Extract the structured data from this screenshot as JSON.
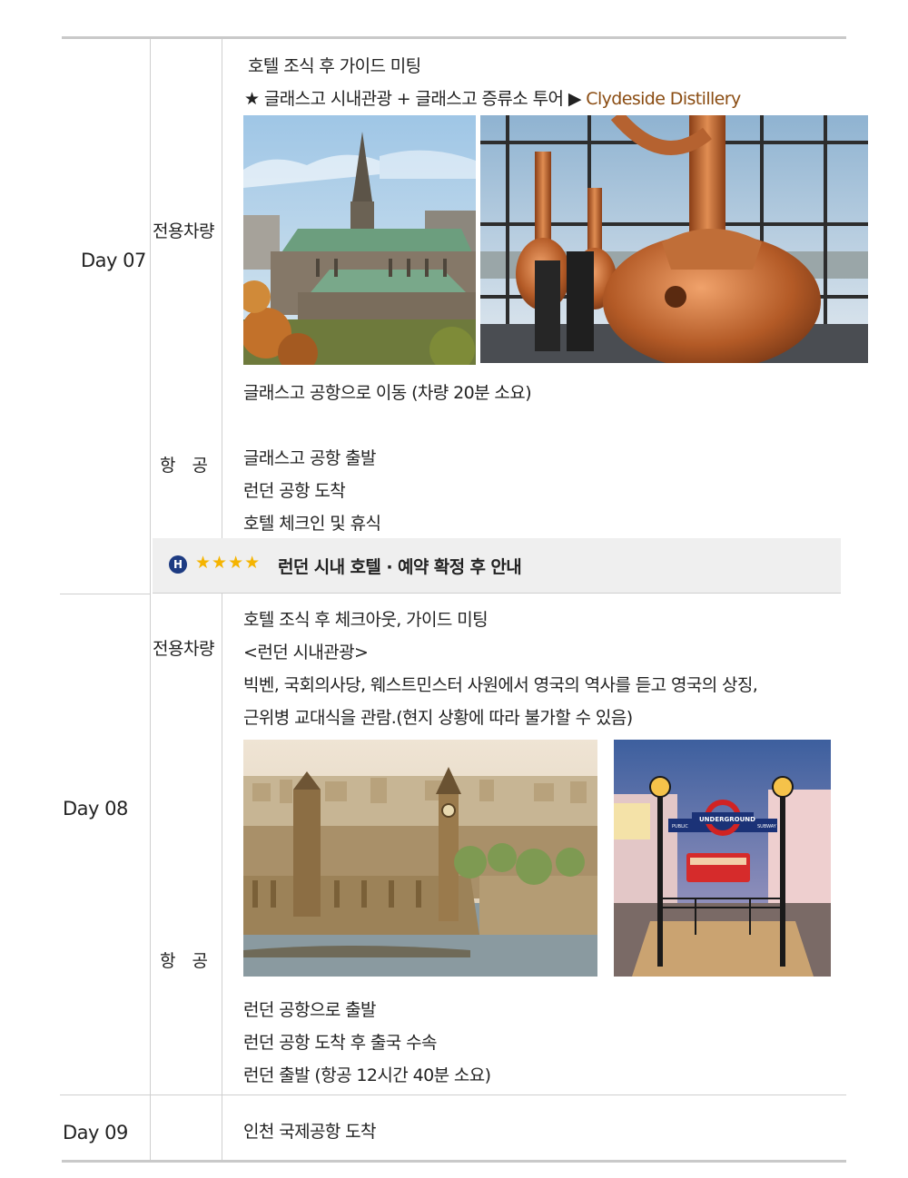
{
  "days": [
    {
      "day": "Day 07",
      "transport_car": "전용차량",
      "transport_air": "항　공",
      "lines_top": [
        "호텔 조식 후 가이드 미팅"
      ],
      "tour_star": "★ 글래스고 시내관광  + 글래스고 증류소 투어",
      "tour_arrow": "▶",
      "tour_highlight": "Clydeside Distillery",
      "photos": [
        "Glasgow Cathedral",
        "Clydeside Distillery copper stills"
      ],
      "lines_bottom": [
        "글래스고 공항으로 이동 (차량 20분 소요)",
        "글래스고 공항 출발",
        "런던 공항 도착",
        "호텔 체크인 및 휴식"
      ],
      "hotel": {
        "icon": "H",
        "stars": "★★★★",
        "text": "런던 시내 호텔 · 예약 확정 후 안내"
      }
    },
    {
      "day": "Day 08",
      "transport_car": "전용차량",
      "transport_air": "항　공",
      "lines_top": [
        "호텔 조식 후 체크아웃, 가이드 미팅",
        "<런던 시내관광>",
        "빅벤, 국회의사당, 웨스트민스터 사원에서 영국의 역사를 듣고 영국의 상징,",
        "근위병 교대식을 관람.(현지 상황에 따라 불가할 수 있음)"
      ],
      "photos": [
        "London Westminster aerial",
        "Piccadilly Underground entrance"
      ],
      "underground_sign": [
        "PUBLIC",
        "UNDERGROUND",
        "SUBWAY"
      ],
      "lines_bottom": [
        "런던 공항으로 출발",
        "런던 공항 도착 후 출국 수속",
        "런던 출발 (항공 12시간 40분 소요)"
      ]
    },
    {
      "day": "Day 09",
      "lines_top": [
        "인천 국제공항 도착"
      ]
    }
  ]
}
